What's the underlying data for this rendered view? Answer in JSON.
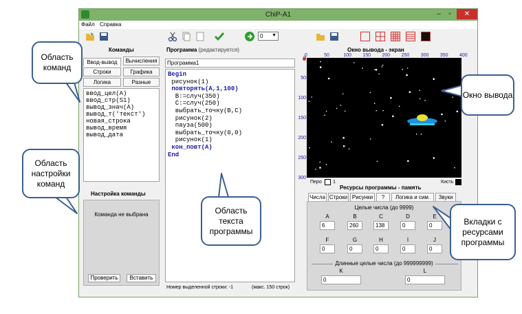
{
  "window": {
    "title": "ChiP-A1"
  },
  "menu": [
    "Файл",
    "Справка"
  ],
  "toolbar": {
    "dropdown_value": "0"
  },
  "commands": {
    "title": "Команды",
    "tabs": [
      "Ввод-вывод",
      "Вычисления",
      "Строки",
      "Графика",
      "Логика",
      "Разные"
    ],
    "items": [
      "ввод_цел(A)",
      "ввод_стр(S1)",
      "вывод_знач(A)",
      "вывод_т('текст')",
      "новая_строка",
      "вывод_время",
      "вывод_дата"
    ]
  },
  "settings": {
    "title": "Настройка команды",
    "status": "Команда не выбрана",
    "check_label": "Проверить",
    "insert_label": "Вставить"
  },
  "program": {
    "title": "Программа",
    "subtitle": "(редактируется)",
    "name": "Программа1",
    "lines": [
      {
        "text": "Begin",
        "kw": true
      },
      {
        "text": " рисунок(1)",
        "kw": false
      },
      {
        "text": " повторять(A,1,100)",
        "kw": true
      },
      {
        "text": "  B:=случ(350)",
        "kw": false
      },
      {
        "text": "  C:=случ(250)",
        "kw": false
      },
      {
        "text": "  выбрать_точку(B,C)",
        "kw": false
      },
      {
        "text": "  рисунок(2)",
        "kw": false
      },
      {
        "text": "  пауза(500)",
        "kw": false
      },
      {
        "text": "  выбрать_точку(0,0)",
        "kw": false
      },
      {
        "text": "  рисунок(1)",
        "kw": false
      },
      {
        "text": " кон_повт(A)",
        "kw": true
      },
      {
        "text": "End",
        "kw": true
      }
    ],
    "status_line": "Номер выделенной строки:  -1",
    "status_max": "(макс. 150 строк)"
  },
  "output": {
    "title": "Окно вывода - экран",
    "x_ticks": [
      "0",
      "50",
      "100",
      "150",
      "200",
      "250",
      "300",
      "350",
      "400"
    ],
    "y_ticks": [
      "0",
      "50",
      "100",
      "150",
      "200",
      "250",
      "300"
    ],
    "pen_label": "Перо",
    "pen_value": "1",
    "brush_label": "Кисть"
  },
  "resources": {
    "title": "Ресурсы программы - память",
    "tabs": [
      "Числа",
      "Строки",
      "Рисунки",
      "?",
      "Логика и сим.",
      "Звуки"
    ],
    "int_title": "Целые числа (до 9999)",
    "vars_row1": [
      {
        "name": "A",
        "value": "6"
      },
      {
        "name": "B",
        "value": "260"
      },
      {
        "name": "C",
        "value": "138"
      },
      {
        "name": "D",
        "value": "0"
      },
      {
        "name": "E",
        "value": "0"
      }
    ],
    "vars_row2": [
      {
        "name": "F",
        "value": "0"
      },
      {
        "name": "G",
        "value": "0"
      },
      {
        "name": "H",
        "value": "0"
      },
      {
        "name": "I",
        "value": "0"
      },
      {
        "name": "J",
        "value": "0"
      }
    ],
    "long_title": "Длинные целые числа (до 999999999)",
    "long_vars": [
      {
        "name": "K",
        "value": "0"
      },
      {
        "name": "L",
        "value": "0"
      }
    ]
  },
  "callouts": {
    "commands_area": "Область команд",
    "settings_area": "Область настройки команд",
    "program_text": "Область текста программы",
    "output_window": "Окно вывода",
    "resource_tabs": "Вкладки с ресурсами программы"
  },
  "colors": {
    "titlebar": "#7fb26a",
    "callout_border": "#3b5f8f",
    "keyword": "#1a1aa6"
  }
}
